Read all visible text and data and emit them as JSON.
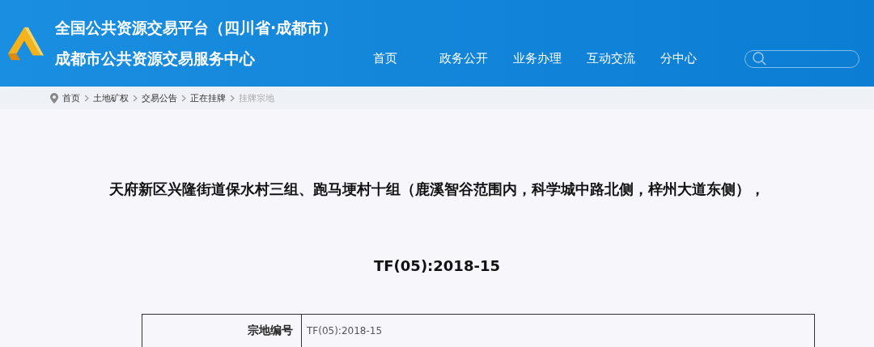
{
  "header": {
    "title": "全国公共资源交易平台（四川省·成都市）",
    "subtitle": "成都市公共资源交易服务中心"
  },
  "nav": [
    {
      "label": "首页"
    },
    {
      "label": "政务公开"
    },
    {
      "label": "业务办理"
    },
    {
      "label": "互动交流"
    },
    {
      "label": "分中心"
    }
  ],
  "breadcrumb": [
    {
      "label": "首页",
      "current": false
    },
    {
      "label": "土地矿权",
      "current": false
    },
    {
      "label": "交易公告",
      "current": false
    },
    {
      "label": "正在挂牌",
      "current": false
    },
    {
      "label": "挂牌宗地",
      "current": true
    }
  ],
  "article": {
    "title": "天府新区兴隆街道保水村三组、跑马埂村十组（鹿溪智谷范围内，科学城中路北侧，梓州大道东侧），TF(05):2018-15"
  },
  "table": {
    "rows": [
      {
        "label": "宗地编号",
        "value": "TF(05):2018-15"
      }
    ]
  }
}
